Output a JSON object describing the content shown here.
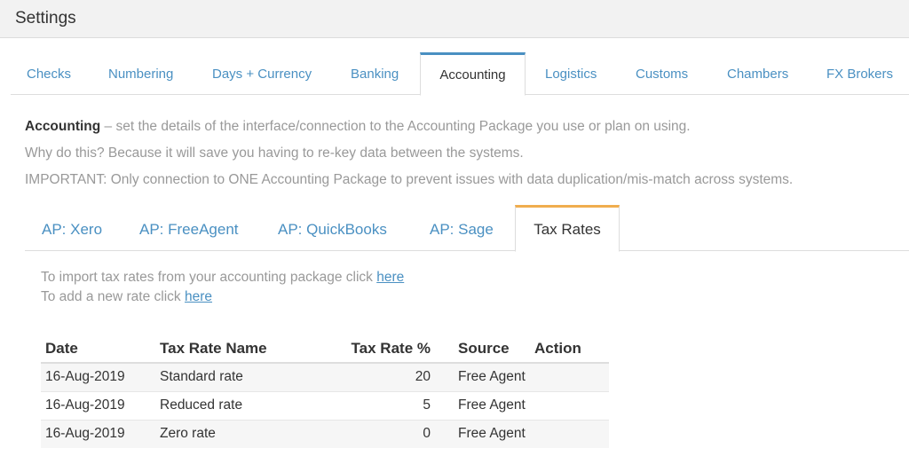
{
  "header": {
    "title": "Settings"
  },
  "main_tabs": [
    {
      "label": "Checks"
    },
    {
      "label": "Numbering"
    },
    {
      "label": "Days + Currency"
    },
    {
      "label": "Banking"
    },
    {
      "label": "Accounting",
      "active": true
    },
    {
      "label": "Logistics"
    },
    {
      "label": "Customs"
    },
    {
      "label": "Chambers"
    },
    {
      "label": "FX Brokers"
    }
  ],
  "description": {
    "heading": "Accounting",
    "line1": " – set the details of the interface/connection to the Accounting Package you use or plan on using.",
    "line2": "Why do this? Because it will save you having to re-key data between the systems.",
    "line3": "IMPORTANT: Only connection to ONE Accounting Package to prevent issues with data duplication/mis-match across systems."
  },
  "sub_tabs": [
    {
      "label": "AP: Xero"
    },
    {
      "label": "AP: FreeAgent"
    },
    {
      "label": "AP: QuickBooks"
    },
    {
      "label": "AP: Sage"
    },
    {
      "label": "Tax Rates",
      "active": true
    }
  ],
  "tax_rates": {
    "import_text": "To import tax rates from your accounting package click ",
    "import_link": "here",
    "add_text": "To add a new rate click ",
    "add_link": "here",
    "columns": [
      "Date",
      "Tax Rate Name",
      "Tax Rate %",
      "Source",
      "Action"
    ],
    "rows": [
      {
        "date": "16-Aug-2019",
        "name": "Standard rate",
        "rate": "20",
        "source": "Free Agent",
        "action": ""
      },
      {
        "date": "16-Aug-2019",
        "name": "Reduced rate",
        "rate": "5",
        "source": "Free Agent",
        "action": ""
      },
      {
        "date": "16-Aug-2019",
        "name": "Zero rate",
        "rate": "0",
        "source": "Free Agent",
        "action": ""
      }
    ]
  },
  "colors": {
    "link": "#4a90c2",
    "main_tab_accent": "#4a90c2",
    "sub_tab_accent": "#f0ad4e"
  }
}
